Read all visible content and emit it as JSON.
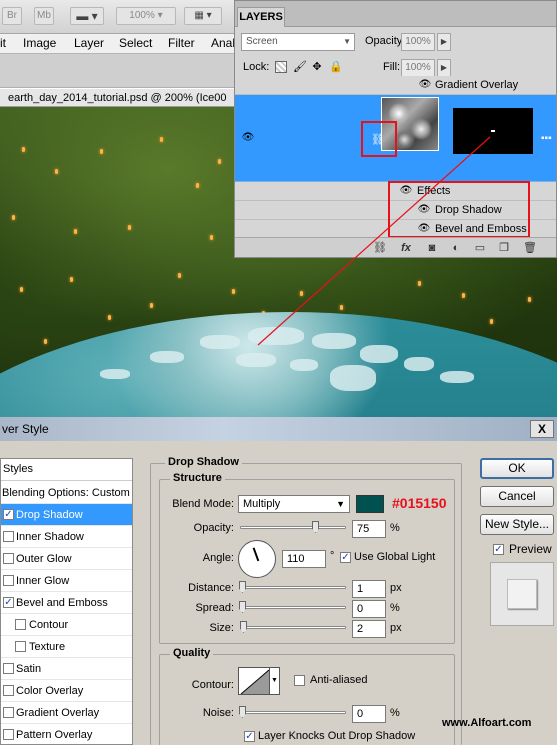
{
  "app_bar": {
    "br_label": "Br",
    "mb_label": "Mb",
    "zoom_value": "100%"
  },
  "menu": [
    "it",
    "Image",
    "Layer",
    "Select",
    "Filter",
    "Anal"
  ],
  "document": {
    "tab_title": "earth_day_2014_tutorial.psd @ 200% (Ice00"
  },
  "layers": {
    "tab_label": "LAYERS",
    "blend_mode": "Screen",
    "opacity_label": "Opacity:",
    "opacity_value": "100%",
    "lock_label": "Lock:",
    "fill_label": "Fill:",
    "fill_value": "100%",
    "gradient_overlay": "Gradient Overlay",
    "effects_label": "Effects",
    "effect_items": [
      "Drop Shadow",
      "Bevel and Emboss"
    ]
  },
  "dialog": {
    "title": "ver Style",
    "close_label": "X",
    "styles_header": "Styles",
    "blending_options": "Blending Options: Custom",
    "style_items": [
      {
        "label": "Drop Shadow",
        "checked": true,
        "selected": true
      },
      {
        "label": "Inner Shadow",
        "checked": false
      },
      {
        "label": "Outer Glow",
        "checked": false
      },
      {
        "label": "Inner Glow",
        "checked": false
      },
      {
        "label": "Bevel and Emboss",
        "checked": true
      },
      {
        "label": "Contour",
        "checked": false,
        "indent": true
      },
      {
        "label": "Texture",
        "checked": false,
        "indent": true
      },
      {
        "label": "Satin",
        "checked": false
      },
      {
        "label": "Color Overlay",
        "checked": false
      },
      {
        "label": "Gradient Overlay",
        "checked": false
      },
      {
        "label": "Pattern Overlay",
        "checked": false
      }
    ],
    "section_title": "Drop Shadow",
    "structure": {
      "title": "Structure",
      "blend_mode_label": "Blend Mode:",
      "blend_mode_value": "Multiply",
      "color_hex": "#015150",
      "opacity_label": "Opacity:",
      "opacity_value": "75",
      "opacity_unit": "%",
      "opacity_level": 0.75,
      "angle_label": "Angle:",
      "angle_value": "110",
      "angle_unit": "°",
      "use_global_light": "Use Global Light",
      "use_global_light_checked": true,
      "distance_label": "Distance:",
      "distance_value": "1",
      "distance_unit": "px",
      "spread_label": "Spread:",
      "spread_value": "0",
      "spread_unit": "%",
      "size_label": "Size:",
      "size_value": "2",
      "size_unit": "px"
    },
    "quality": {
      "title": "Quality",
      "contour_label": "Contour:",
      "anti_aliased": "Anti-aliased",
      "anti_aliased_checked": false,
      "noise_label": "Noise:",
      "noise_value": "0",
      "noise_unit": "%",
      "knocks_out": "Layer Knocks Out Drop Shadow",
      "knocks_out_checked": true
    },
    "buttons": {
      "ok": "OK",
      "cancel": "Cancel",
      "new_style": "New Style...",
      "preview": "Preview",
      "preview_checked": true
    }
  },
  "watermark": "www.Alfoart.com",
  "colors": {
    "selection": "#3399ff",
    "highlight": "#e8101a",
    "shadow_color": "#015150"
  }
}
